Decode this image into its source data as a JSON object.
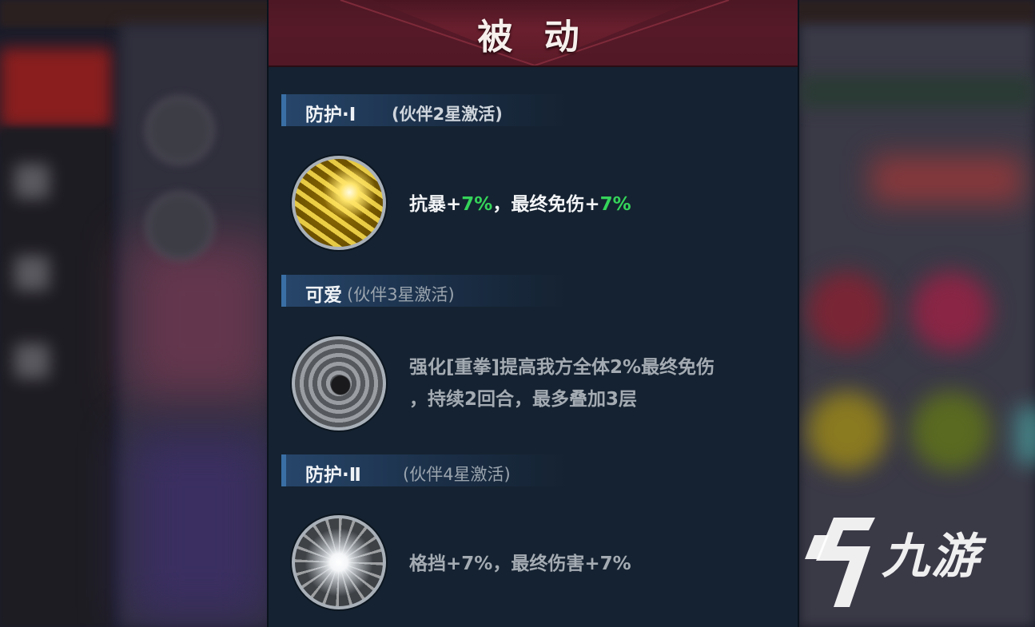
{
  "panel": {
    "title": "被 动",
    "sections": [
      {
        "name": "防护·Ⅰ",
        "note": "(伙伴2星激活)",
        "icon": "gold-shield-burst-icon",
        "desc_parts": [
          "抗暴+",
          "7%",
          "，最终免伤+",
          "7%"
        ]
      },
      {
        "name": "可爱",
        "note": "(伙伴3星激活)",
        "icon": "grey-swirl-figure-icon",
        "desc_lines": [
          "强化[重拳]提高我方全体2%最终免伤",
          "，持续2回合，最多叠加3层"
        ]
      },
      {
        "name": "防护·Ⅱ",
        "note": "(伙伴4星激活)",
        "icon": "white-starburst-icon",
        "desc": "格挡+7%，最终伤害+7%"
      }
    ]
  },
  "watermark": {
    "text": "九游",
    "logo": "jiuyou-logo-icon"
  },
  "colors": {
    "header": "#6a1f2e",
    "panel_bg": "#152231",
    "highlight_green": "#35d45a",
    "section_bar": "#284870"
  }
}
